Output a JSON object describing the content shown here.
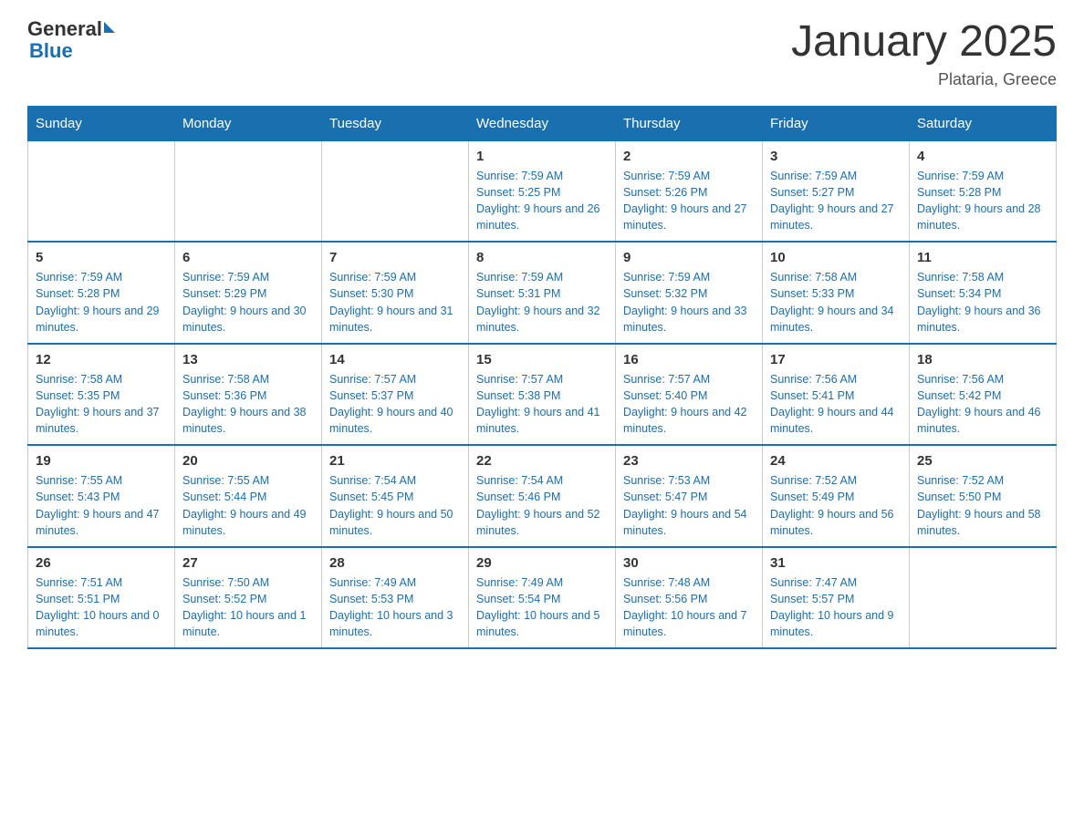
{
  "header": {
    "logo_general": "General",
    "logo_blue": "Blue",
    "title": "January 2025",
    "subtitle": "Plataria, Greece"
  },
  "days_of_week": [
    "Sunday",
    "Monday",
    "Tuesday",
    "Wednesday",
    "Thursday",
    "Friday",
    "Saturday"
  ],
  "weeks": [
    [
      {
        "day": "",
        "info": ""
      },
      {
        "day": "",
        "info": ""
      },
      {
        "day": "",
        "info": ""
      },
      {
        "day": "1",
        "info": "Sunrise: 7:59 AM\nSunset: 5:25 PM\nDaylight: 9 hours and 26 minutes."
      },
      {
        "day": "2",
        "info": "Sunrise: 7:59 AM\nSunset: 5:26 PM\nDaylight: 9 hours and 27 minutes."
      },
      {
        "day": "3",
        "info": "Sunrise: 7:59 AM\nSunset: 5:27 PM\nDaylight: 9 hours and 27 minutes."
      },
      {
        "day": "4",
        "info": "Sunrise: 7:59 AM\nSunset: 5:28 PM\nDaylight: 9 hours and 28 minutes."
      }
    ],
    [
      {
        "day": "5",
        "info": "Sunrise: 7:59 AM\nSunset: 5:28 PM\nDaylight: 9 hours and 29 minutes."
      },
      {
        "day": "6",
        "info": "Sunrise: 7:59 AM\nSunset: 5:29 PM\nDaylight: 9 hours and 30 minutes."
      },
      {
        "day": "7",
        "info": "Sunrise: 7:59 AM\nSunset: 5:30 PM\nDaylight: 9 hours and 31 minutes."
      },
      {
        "day": "8",
        "info": "Sunrise: 7:59 AM\nSunset: 5:31 PM\nDaylight: 9 hours and 32 minutes."
      },
      {
        "day": "9",
        "info": "Sunrise: 7:59 AM\nSunset: 5:32 PM\nDaylight: 9 hours and 33 minutes."
      },
      {
        "day": "10",
        "info": "Sunrise: 7:58 AM\nSunset: 5:33 PM\nDaylight: 9 hours and 34 minutes."
      },
      {
        "day": "11",
        "info": "Sunrise: 7:58 AM\nSunset: 5:34 PM\nDaylight: 9 hours and 36 minutes."
      }
    ],
    [
      {
        "day": "12",
        "info": "Sunrise: 7:58 AM\nSunset: 5:35 PM\nDaylight: 9 hours and 37 minutes."
      },
      {
        "day": "13",
        "info": "Sunrise: 7:58 AM\nSunset: 5:36 PM\nDaylight: 9 hours and 38 minutes."
      },
      {
        "day": "14",
        "info": "Sunrise: 7:57 AM\nSunset: 5:37 PM\nDaylight: 9 hours and 40 minutes."
      },
      {
        "day": "15",
        "info": "Sunrise: 7:57 AM\nSunset: 5:38 PM\nDaylight: 9 hours and 41 minutes."
      },
      {
        "day": "16",
        "info": "Sunrise: 7:57 AM\nSunset: 5:40 PM\nDaylight: 9 hours and 42 minutes."
      },
      {
        "day": "17",
        "info": "Sunrise: 7:56 AM\nSunset: 5:41 PM\nDaylight: 9 hours and 44 minutes."
      },
      {
        "day": "18",
        "info": "Sunrise: 7:56 AM\nSunset: 5:42 PM\nDaylight: 9 hours and 46 minutes."
      }
    ],
    [
      {
        "day": "19",
        "info": "Sunrise: 7:55 AM\nSunset: 5:43 PM\nDaylight: 9 hours and 47 minutes."
      },
      {
        "day": "20",
        "info": "Sunrise: 7:55 AM\nSunset: 5:44 PM\nDaylight: 9 hours and 49 minutes."
      },
      {
        "day": "21",
        "info": "Sunrise: 7:54 AM\nSunset: 5:45 PM\nDaylight: 9 hours and 50 minutes."
      },
      {
        "day": "22",
        "info": "Sunrise: 7:54 AM\nSunset: 5:46 PM\nDaylight: 9 hours and 52 minutes."
      },
      {
        "day": "23",
        "info": "Sunrise: 7:53 AM\nSunset: 5:47 PM\nDaylight: 9 hours and 54 minutes."
      },
      {
        "day": "24",
        "info": "Sunrise: 7:52 AM\nSunset: 5:49 PM\nDaylight: 9 hours and 56 minutes."
      },
      {
        "day": "25",
        "info": "Sunrise: 7:52 AM\nSunset: 5:50 PM\nDaylight: 9 hours and 58 minutes."
      }
    ],
    [
      {
        "day": "26",
        "info": "Sunrise: 7:51 AM\nSunset: 5:51 PM\nDaylight: 10 hours and 0 minutes."
      },
      {
        "day": "27",
        "info": "Sunrise: 7:50 AM\nSunset: 5:52 PM\nDaylight: 10 hours and 1 minute."
      },
      {
        "day": "28",
        "info": "Sunrise: 7:49 AM\nSunset: 5:53 PM\nDaylight: 10 hours and 3 minutes."
      },
      {
        "day": "29",
        "info": "Sunrise: 7:49 AM\nSunset: 5:54 PM\nDaylight: 10 hours and 5 minutes."
      },
      {
        "day": "30",
        "info": "Sunrise: 7:48 AM\nSunset: 5:56 PM\nDaylight: 10 hours and 7 minutes."
      },
      {
        "day": "31",
        "info": "Sunrise: 7:47 AM\nSunset: 5:57 PM\nDaylight: 10 hours and 9 minutes."
      },
      {
        "day": "",
        "info": ""
      }
    ]
  ]
}
